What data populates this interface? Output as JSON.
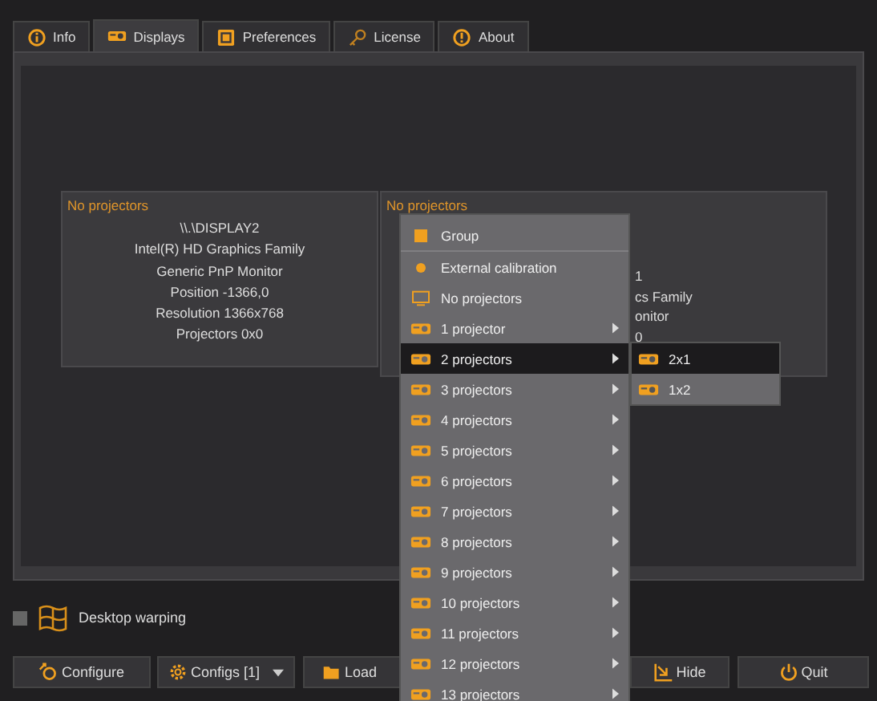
{
  "tabs": [
    {
      "label": "Info",
      "kind": "info",
      "selected": false
    },
    {
      "label": "Displays",
      "kind": "projector",
      "selected": true
    },
    {
      "label": "Preferences",
      "kind": "prefs",
      "selected": false
    },
    {
      "label": "License",
      "kind": "key",
      "selected": false
    },
    {
      "label": "About",
      "kind": "about",
      "selected": false
    }
  ],
  "displays": [
    {
      "header": "No projectors",
      "lines": [
        "\\\\.\\DISPLAY2",
        "Intel(R) HD Graphics Family",
        "Generic PnP Monitor",
        "Position -1366,0",
        "Resolution 1366x768",
        "Projectors 0x0"
      ]
    },
    {
      "header": "No projectors",
      "lines": [
        "1",
        "cs Family",
        "onitor",
        "0"
      ]
    }
  ],
  "menu": {
    "items": [
      {
        "kind": "group",
        "label": "Group",
        "selected": false
      },
      {
        "kind": "calibration",
        "label": "External calibration",
        "selected": false
      },
      {
        "kind": "monitor",
        "label": "No projectors",
        "selected": false
      },
      {
        "kind": "projector",
        "label": "1 projector",
        "selected": false
      },
      {
        "kind": "projector",
        "label": "2 projectors",
        "selected": true
      },
      {
        "kind": "projector",
        "label": "3 projectors",
        "selected": false
      },
      {
        "kind": "projector",
        "label": "4 projectors",
        "selected": false
      },
      {
        "kind": "projector",
        "label": "5 projectors",
        "selected": false
      },
      {
        "kind": "projector",
        "label": "6 projectors",
        "selected": false
      },
      {
        "kind": "projector",
        "label": "7 projectors",
        "selected": false
      },
      {
        "kind": "projector",
        "label": "8 projectors",
        "selected": false
      },
      {
        "kind": "projector",
        "label": "9 projectors",
        "selected": false
      },
      {
        "kind": "projector",
        "label": "10 projectors",
        "selected": false
      },
      {
        "kind": "projector",
        "label": "11 projectors",
        "selected": false
      },
      {
        "kind": "projector",
        "label": "12 projectors",
        "selected": false
      },
      {
        "kind": "projector",
        "label": "13 projectors",
        "selected": false
      }
    ],
    "submenu": [
      {
        "label": "2x1",
        "selected": true
      },
      {
        "label": "1x2",
        "selected": false
      }
    ]
  },
  "desktop_warping": {
    "label": "Desktop warping",
    "checked": false
  },
  "buttons": [
    {
      "label": "Configure",
      "kind": "configure",
      "dropdown": false
    },
    {
      "label": "Configs [1]",
      "kind": "gear",
      "dropdown": true
    },
    {
      "label": "Load",
      "kind": "folder",
      "dropdown": false
    },
    {
      "label": "Hide",
      "kind": "hide",
      "dropdown": false
    },
    {
      "label": "Quit",
      "kind": "power",
      "dropdown": false
    }
  ]
}
